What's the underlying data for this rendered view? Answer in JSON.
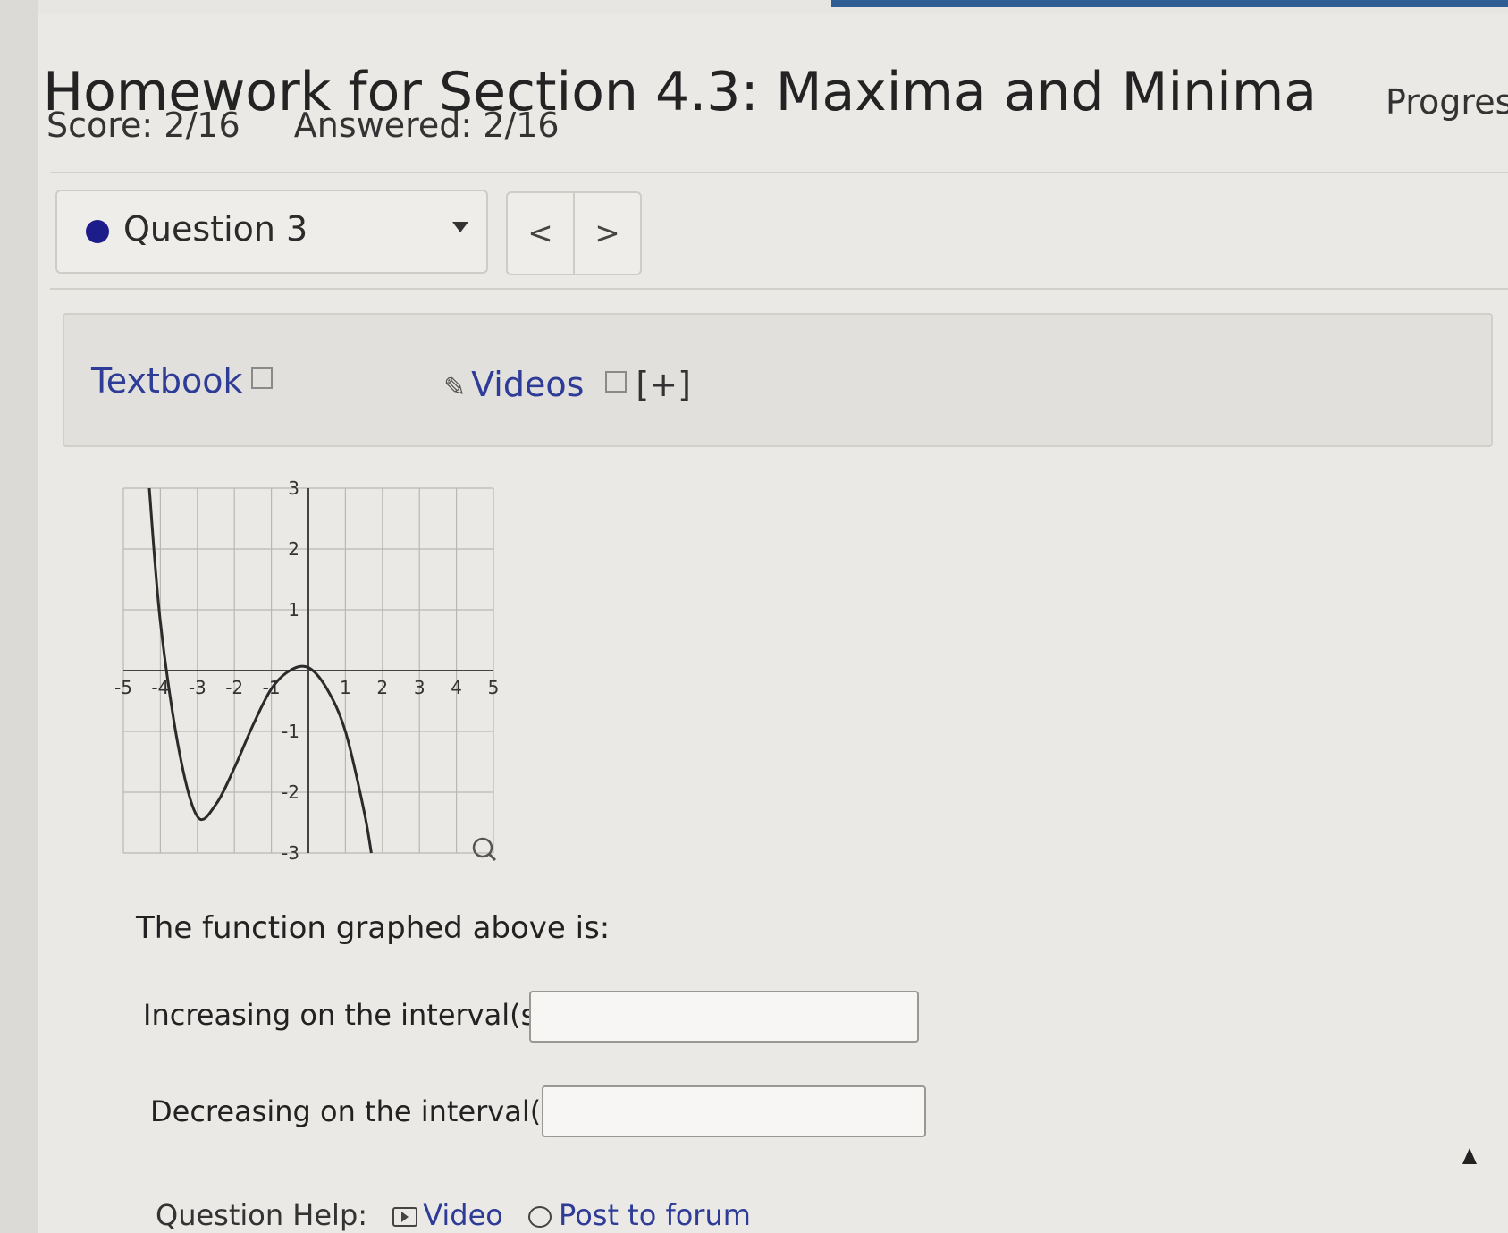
{
  "header": {
    "title": "Homework for Section 4.3: Maxima and Minima",
    "score": "Score: 2/16",
    "answered": "Answered: 2/16",
    "progress": "Progress"
  },
  "question_nav": {
    "selected": "Question 3",
    "prev": "<",
    "next": ">"
  },
  "resources": {
    "textbook": "Textbook",
    "videos": "Videos",
    "expand": "[+]"
  },
  "chart_data": {
    "type": "line",
    "xlim": [
      -5,
      5
    ],
    "ylim": [
      -3,
      3
    ],
    "x_ticks": [
      "-5",
      "-4",
      "-3",
      "-2",
      "-1",
      "1",
      "2",
      "3",
      "4",
      "5"
    ],
    "y_ticks": [
      "3",
      "2",
      "1",
      "-1",
      "-2",
      "-3"
    ],
    "grid": true,
    "series": [
      {
        "x": [
          -4.3,
          -4,
          -3.5,
          -3,
          -2.5,
          -2,
          -1.5,
          -1,
          -0.5,
          0,
          0.5,
          1,
          1.5,
          1.7
        ],
        "y": [
          3.0,
          0.8,
          -1.3,
          -2.4,
          -2.2,
          -1.6,
          -0.9,
          -0.3,
          0.0,
          0.05,
          -0.3,
          -1.0,
          -2.3,
          -3.0
        ]
      }
    ]
  },
  "question": {
    "prompt": "The function graphed above is:",
    "increasing_label": "Increasing on the interval(s)",
    "increasing_value": "",
    "decreasing_label": "Decreasing on the interval(s)",
    "decreasing_value": ""
  },
  "help": {
    "label": "Question Help:",
    "video": "Video",
    "forum": "Post to forum"
  }
}
